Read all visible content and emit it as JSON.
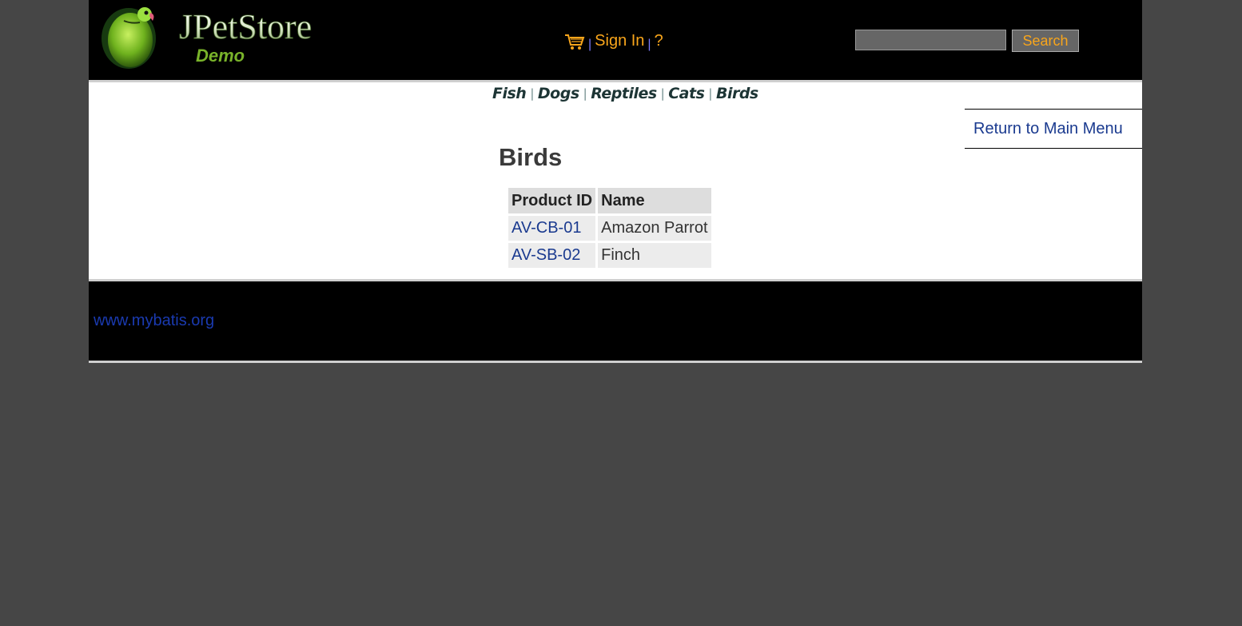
{
  "header": {
    "logo_text": "JPetStore",
    "logo_subtext": "Demo",
    "sign_in_label": "Sign In",
    "help_label": "?",
    "search_placeholder": "",
    "search_button_label": "Search"
  },
  "quick_links": [
    {
      "label": "Fish"
    },
    {
      "label": "Dogs"
    },
    {
      "label": "Reptiles"
    },
    {
      "label": "Cats"
    },
    {
      "label": "Birds"
    }
  ],
  "back_link_label": "Return to Main Menu",
  "page_title": "Birds",
  "table": {
    "columns": [
      "Product ID",
      "Name"
    ],
    "rows": [
      {
        "product_id": "AV-CB-01",
        "name": "Amazon Parrot"
      },
      {
        "product_id": "AV-SB-02",
        "name": "Finch"
      }
    ]
  },
  "footer": {
    "link_label": "www.mybatis.org"
  },
  "colors": {
    "page_background": "#464646",
    "header_background": "#000000",
    "menu_link": "#f8a51b",
    "link": "#1a3a8f"
  }
}
